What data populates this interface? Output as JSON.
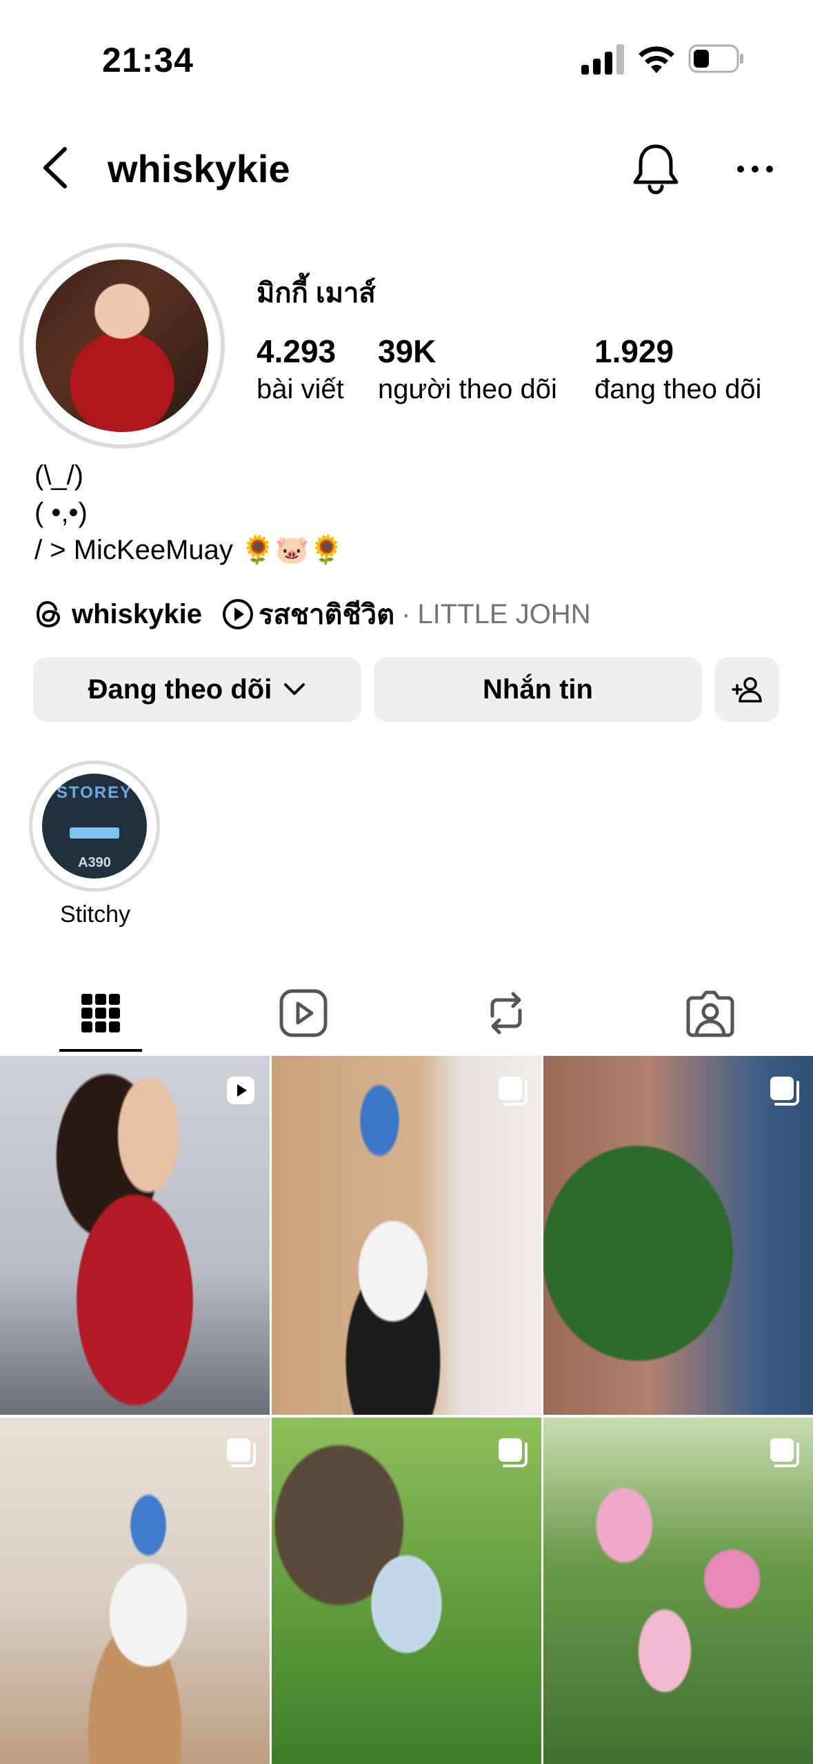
{
  "status_bar": {
    "time": "21:34"
  },
  "header": {
    "username": "whiskykie"
  },
  "profile": {
    "display_name": "มิกกี้ เมาส์",
    "stats": [
      {
        "value": "4.293",
        "label": "bài viết"
      },
      {
        "value": "39K",
        "label": "người theo dõi"
      },
      {
        "value": "1.929",
        "label": "đang theo dõi"
      }
    ],
    "bio_lines": [
      "(\\_/)",
      "( •,•)",
      "/ > MicKeeMuay 🌻🐷🌻"
    ],
    "threads_handle": "whiskykie",
    "song_title": "รสชาติชีวิต",
    "song_separator": "·",
    "song_artist": "LITTLE JOHN"
  },
  "buttons": {
    "following_label": "Đang theo dõi",
    "message_label": "Nhắn tin"
  },
  "highlights": [
    {
      "label": "Stitchy",
      "cover_title": "STOREY",
      "cover_code": "A390"
    }
  ],
  "tabs": [
    "grid-icon",
    "reels-icon",
    "reposts-icon",
    "tagged-icon"
  ],
  "grid_posts": [
    {
      "type": "reel"
    },
    {
      "type": "carousel"
    },
    {
      "type": "carousel"
    },
    {
      "type": "carousel"
    },
    {
      "type": "carousel"
    },
    {
      "type": "carousel"
    }
  ],
  "colors": {
    "button_bg": "#efefef",
    "secondary_text": "#737373",
    "ring": "#dbdbdb"
  }
}
